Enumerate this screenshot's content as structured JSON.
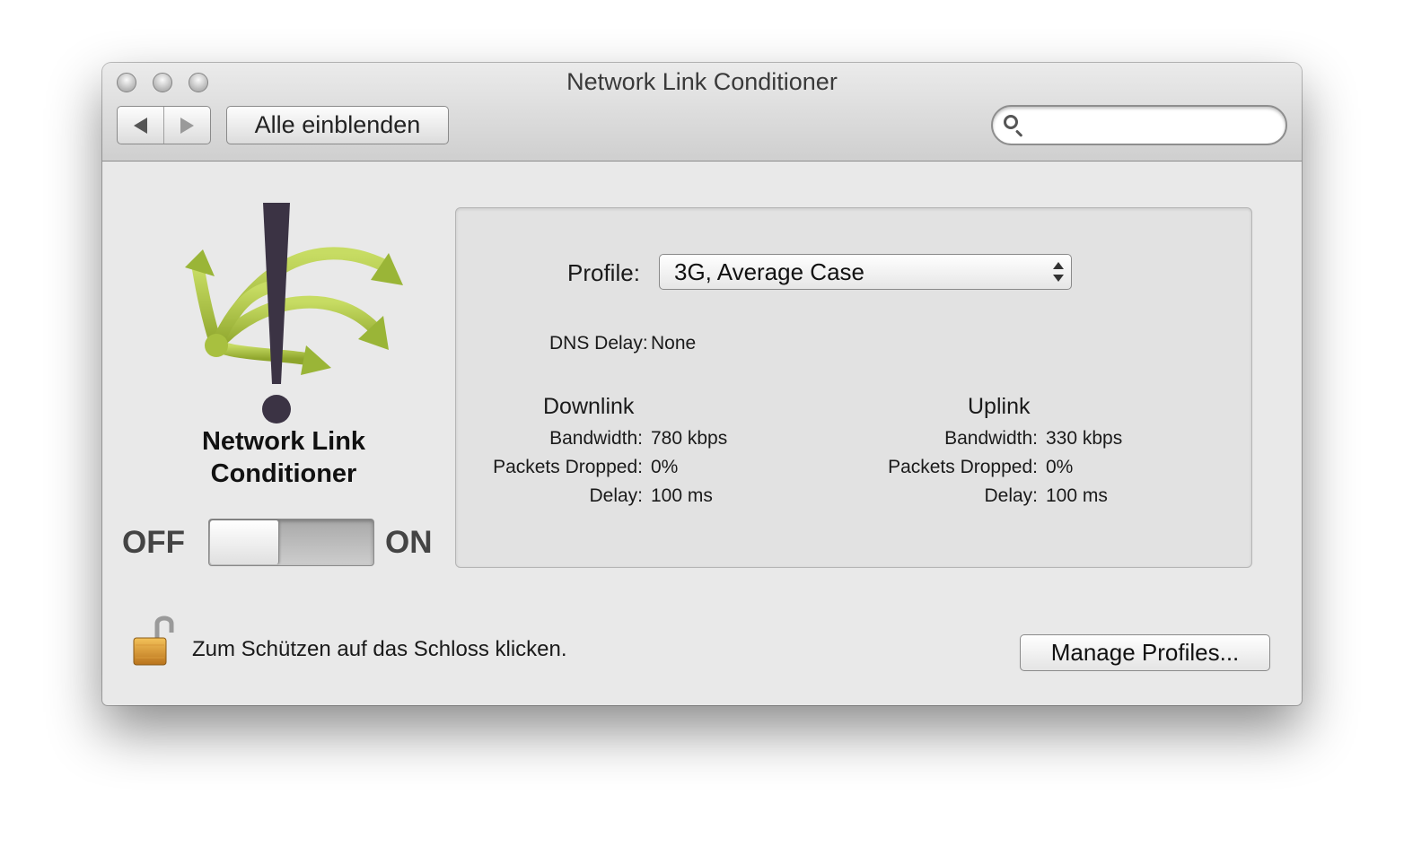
{
  "window": {
    "title": "Network Link Conditioner"
  },
  "toolbar": {
    "back_icon": "chevron-left-icon",
    "forward_icon": "chevron-right-icon",
    "show_all_label": "Alle einblenden",
    "search": {
      "value": "",
      "placeholder": ""
    }
  },
  "app": {
    "name_line1": "Network Link",
    "name_line2": "Conditioner",
    "logo_icon": "network-link-conditioner-logo",
    "colors": {
      "arrows": "#a3bd3c",
      "exclamation": "#3b3344"
    },
    "switch": {
      "off_label": "OFF",
      "on_label": "ON",
      "state": "off"
    }
  },
  "profile": {
    "label": "Profile:",
    "selected": "3G, Average Case"
  },
  "dns": {
    "label": "DNS Delay:",
    "value": "None"
  },
  "downlink": {
    "heading": "Downlink",
    "bandwidth_label": "Bandwidth:",
    "bandwidth_value": "780 kbps",
    "packets_label": "Packets Dropped:",
    "packets_value": "0%",
    "delay_label": "Delay:",
    "delay_value": "100 ms"
  },
  "uplink": {
    "heading": "Uplink",
    "bandwidth_label": "Bandwidth:",
    "bandwidth_value": "330 kbps",
    "packets_label": "Packets Dropped:",
    "packets_value": "0%",
    "delay_label": "Delay:",
    "delay_value": "100 ms"
  },
  "footer": {
    "lock_icon": "padlock-open-icon",
    "lock_text": "Zum Schützen auf das Schloss klicken.",
    "manage_label": "Manage Profiles..."
  }
}
